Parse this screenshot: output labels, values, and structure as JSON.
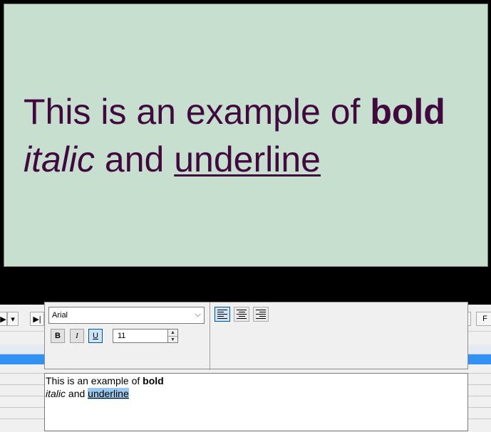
{
  "preview": {
    "line1_prefix": "This is an example of ",
    "line1_bold": "bold",
    "line2_italic": "italic",
    "line2_mid": " and ",
    "line2_underline": "underline",
    "background_color": "#c6dfcf",
    "text_color": "#42093f"
  },
  "timeline": {
    "right_button_label": "F",
    "selection_color": "#3391f2"
  },
  "toolbar": {
    "font": "Arial",
    "bold_label": "B",
    "italic_label": "I",
    "underline_label": "U",
    "underline_active": true,
    "font_size": "11",
    "alignment": "left",
    "align_icons": [
      "align-left-icon",
      "align-center-icon",
      "align-right-icon"
    ]
  },
  "editor": {
    "line1_prefix": "This is an example of ",
    "line1_bold": "bold",
    "line2_italic": "italic",
    "line2_mid": " and ",
    "line2_underline": "underline"
  }
}
